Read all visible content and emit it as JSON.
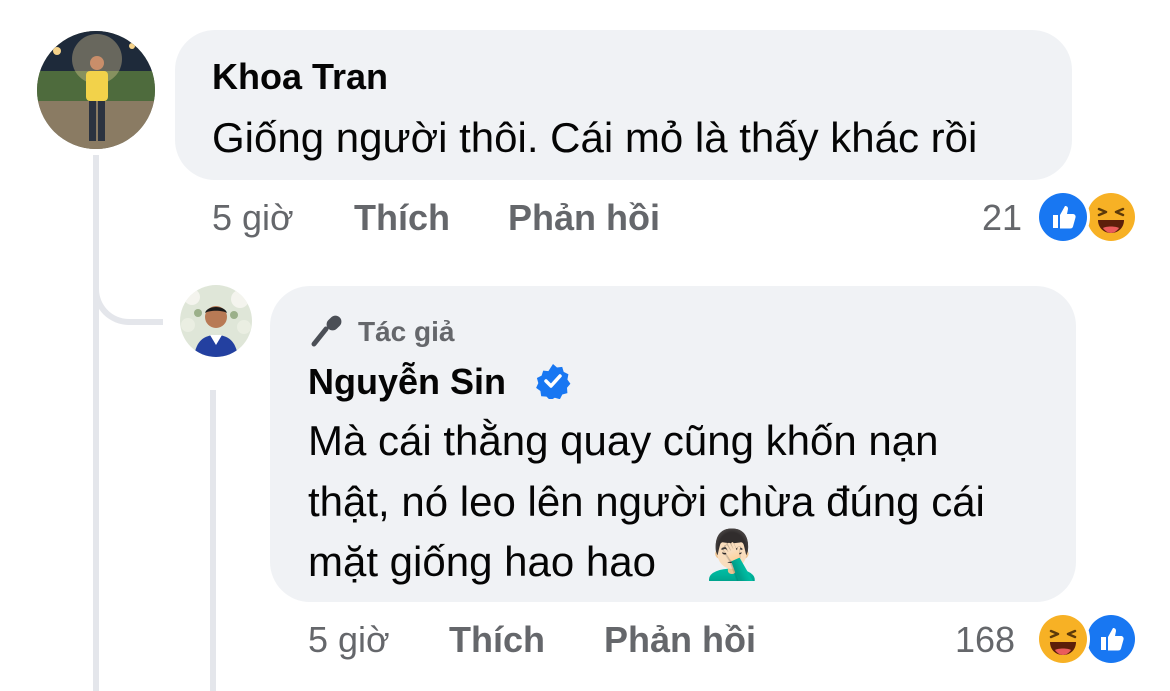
{
  "comments": [
    {
      "author": "Khoa Tran",
      "text": "Giống người thôi. Cái mỏ là thấy khác rồi",
      "time": "5 giờ",
      "like_label": "Thích",
      "reply_label": "Phản hồi",
      "reaction_count": "21",
      "reactions": [
        "like",
        "haha"
      ]
    },
    {
      "author_badge": "Tác giả",
      "author": "Nguyễn Sin",
      "verified": true,
      "text_lines": [
        "Mà cái thằng quay cũng khốn nạn",
        "thật, nó leo lên người chừa đúng cái",
        "mặt giống hao hao"
      ],
      "emoji": "🤦🏻‍♂️",
      "time": "5 giờ",
      "like_label": "Thích",
      "reply_label": "Phản hồi",
      "reaction_count": "168",
      "reactions": [
        "haha",
        "like"
      ]
    }
  ],
  "icons": {
    "like": "like-reaction-icon",
    "haha": "haha-reaction-icon",
    "verified": "verified-badge-icon",
    "author": "microphone-icon"
  },
  "colors": {
    "bubble": "#f0f2f5",
    "meta_text": "#65676b",
    "like_blue": "#1877f2",
    "haha_yellow": "#f7b125"
  }
}
